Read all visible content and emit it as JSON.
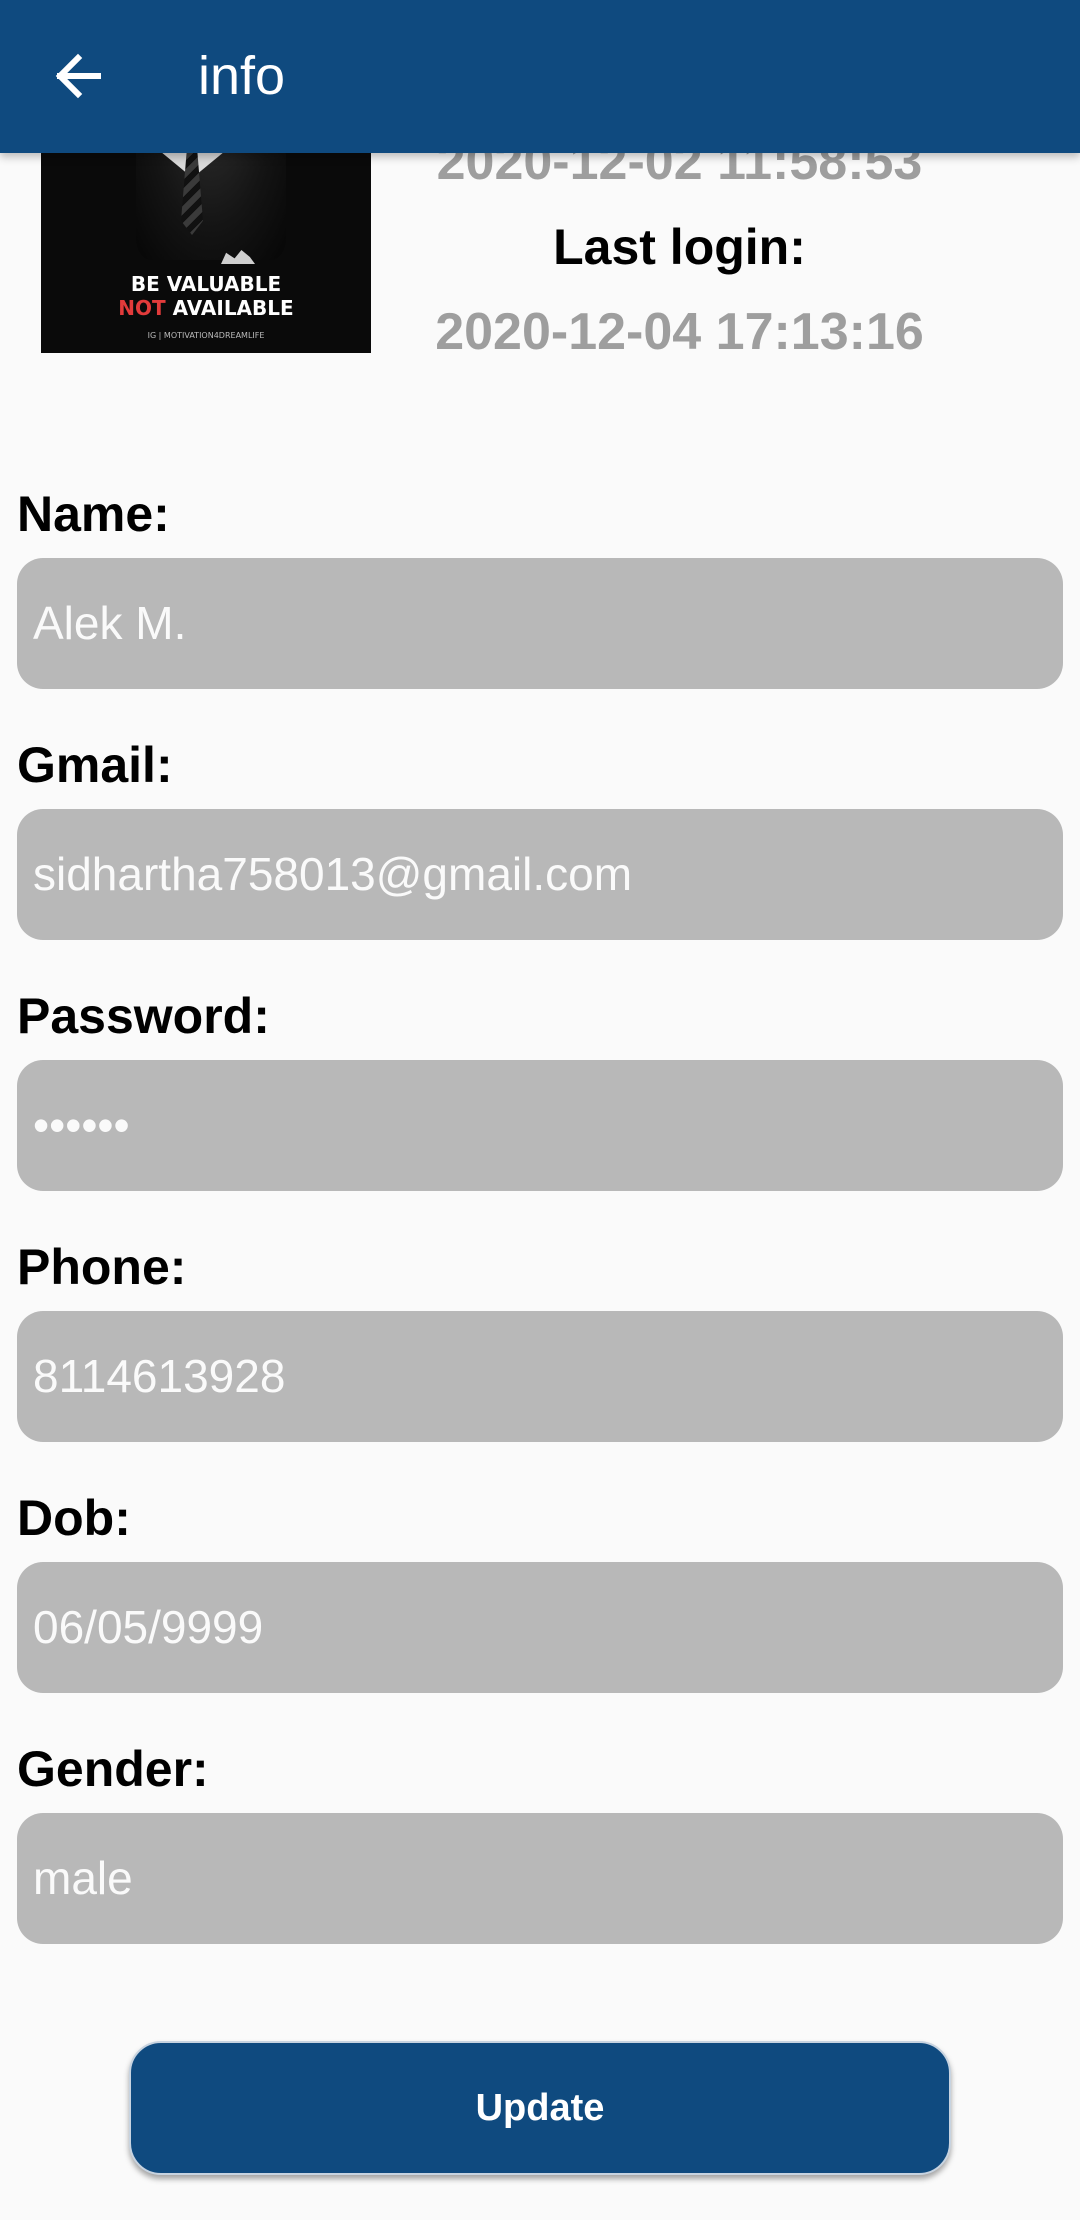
{
  "toolbar": {
    "title": "info",
    "back_icon": "arrow-left-icon"
  },
  "profile": {
    "image_text_line1": "BE VALUABLE",
    "image_text_line2_red": "NOT",
    "image_text_line2_rest": " AVAILABLE",
    "image_text_line3": "IG | MOTIVATION4DREAMLIFE",
    "created_date": "2020-12-02 11:58:53",
    "last_login_label": "Last login:",
    "last_login_date": "2020-12-04 17:13:16"
  },
  "form": {
    "name_label": "Name:",
    "name_value": "Alek M.",
    "gmail_label": "Gmail:",
    "gmail_value": "sidhartha758013@gmail.com",
    "password_label": "Password:",
    "password_value": "••••••",
    "phone_label": "Phone:",
    "phone_value": "8114613928",
    "dob_label": "Dob:",
    "dob_value": "06/05/9999",
    "gender_label": "Gender:",
    "gender_value": "male"
  },
  "actions": {
    "update_label": "Update"
  },
  "colors": {
    "primary": "#0f4a7f",
    "field_background": "#b8b8b8",
    "muted_text": "#9e9e9e"
  }
}
